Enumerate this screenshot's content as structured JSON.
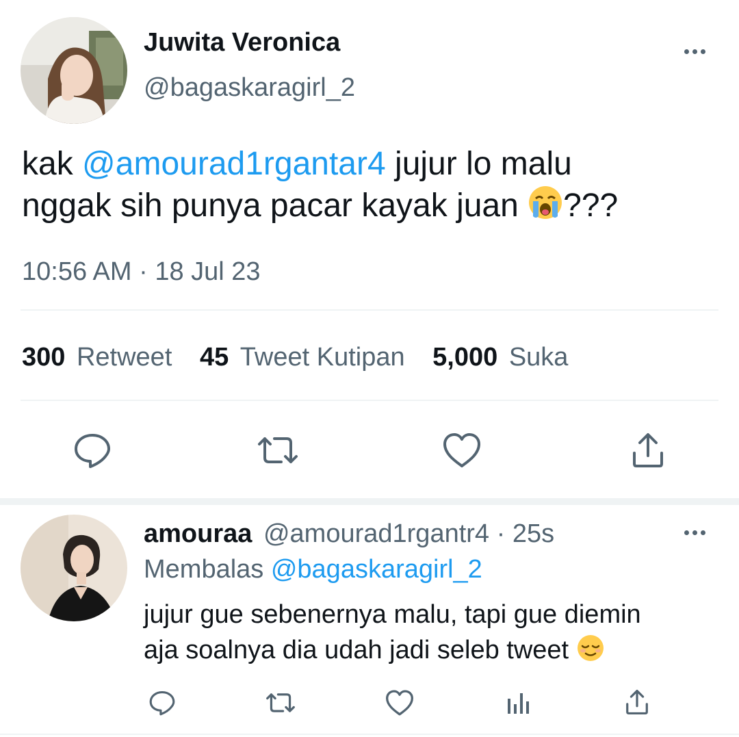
{
  "tweet": {
    "author_name": "Juwita Veronica",
    "author_handle": "@bagaskaragirl_2",
    "text_pre": "kak ",
    "mention": "@amourad1rgantar4",
    "text_line1_post": " jujur lo malu",
    "text_line2": "nggak sih punya pacar kayak juan ",
    "text_end": "???",
    "timestamp": "10:56 AM · 18 Jul 23",
    "stats": {
      "retweets_count": "300",
      "retweets_label": "Retweet",
      "quotes_count": "45",
      "quotes_label": "Tweet Kutipan",
      "likes_count": "5,000",
      "likes_label": "Suka"
    }
  },
  "reply": {
    "author_name": "amouraa",
    "author_handle": "@amourad1rgantr4",
    "time_sep": " · ",
    "time": "25s",
    "replying_label": "Membalas ",
    "replying_to": "@bagaskaragirl_2",
    "text_line1": "jujur gue sebenernya malu, tapi gue diemin",
    "text_line2": "aja soalnya dia udah jadi seleb tweet "
  },
  "icons": {
    "reply": "speech-bubble-icon",
    "retweet": "retweet-arrows-icon",
    "like": "heart-icon",
    "share": "share-upload-icon",
    "analytics": "bar-chart-icon",
    "more": "more-dots-icon",
    "emoji_crying": "loudly-crying-face-emoji",
    "emoji_relieved": "relieved-face-emoji"
  },
  "colors": {
    "link": "#1d9bf0",
    "muted": "#536471",
    "text": "#0f1419",
    "divider": "#eff3f4"
  }
}
